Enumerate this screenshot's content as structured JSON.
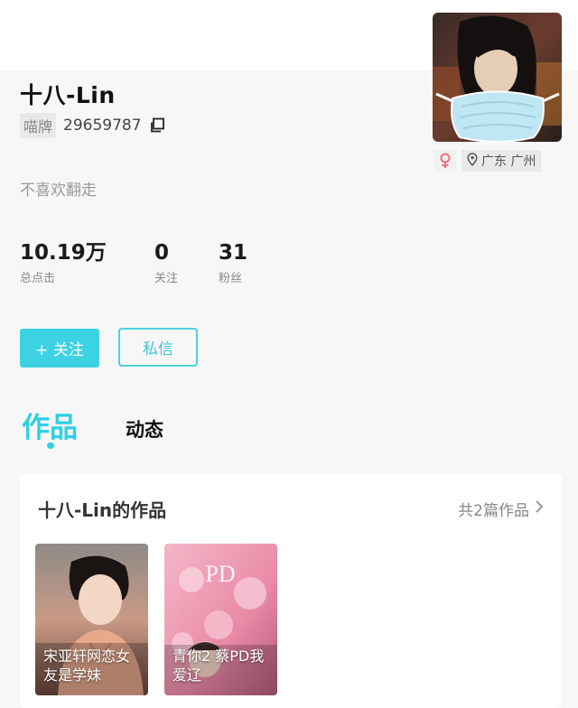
{
  "profile": {
    "name": "十八-Lin",
    "id_label": "喵牌",
    "id_number": "29659787",
    "bio": "不喜欢翻走",
    "location": "广东 广州",
    "gender_icon": "female-symbol",
    "accent_color": "#3dd2e3"
  },
  "stats": [
    {
      "value": "10.19万",
      "label": "总点击"
    },
    {
      "value": "0",
      "label": "关注"
    },
    {
      "value": "31",
      "label": "粉丝"
    }
  ],
  "actions": {
    "follow_label": "+ 关注",
    "message_label": "私信"
  },
  "tabs": [
    {
      "label": "作品",
      "active": true
    },
    {
      "label": "动态",
      "active": false
    }
  ],
  "works": {
    "section_title": "十八-Lin的作品",
    "count_label": "共2篇作品",
    "items": [
      {
        "caption": "宋亚轩网恋女友是学妹"
      },
      {
        "caption": "青你2 蔡PD我爱辽"
      }
    ]
  }
}
